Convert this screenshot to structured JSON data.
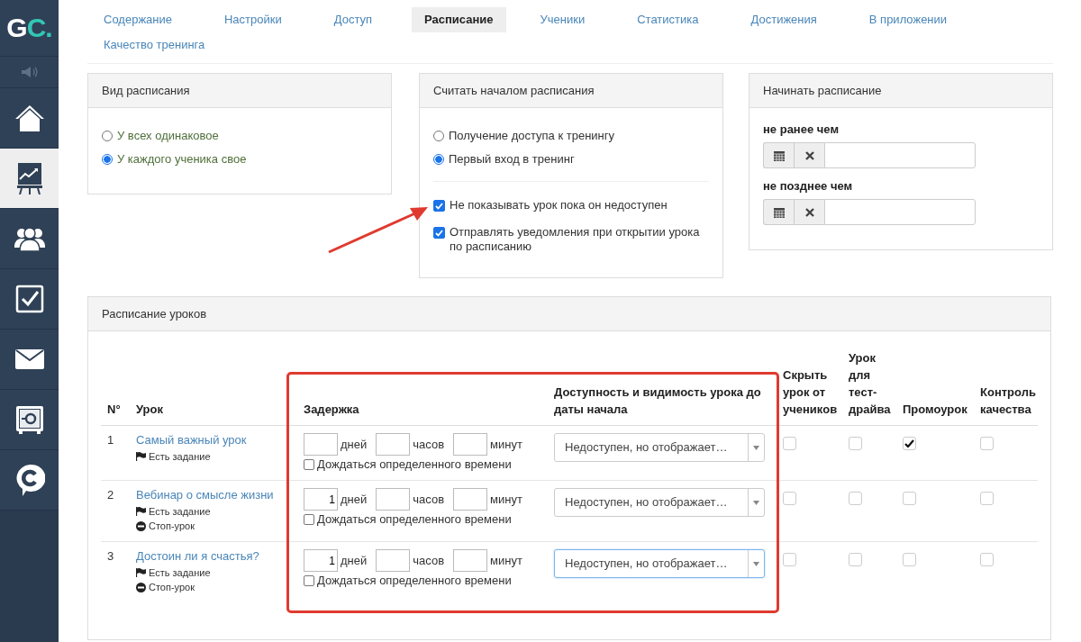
{
  "sidebar": {
    "logo": {
      "letter_1": "G",
      "letter_2": "C",
      "dot": "."
    },
    "items": [
      {
        "kind": "speaker",
        "selected": false
      },
      {
        "kind": "home",
        "selected": false
      },
      {
        "kind": "chart",
        "selected": true
      },
      {
        "kind": "users",
        "selected": false
      },
      {
        "kind": "check",
        "selected": false
      },
      {
        "kind": "mail",
        "selected": false
      },
      {
        "kind": "safe",
        "selected": false
      },
      {
        "kind": "chat",
        "selected": false
      }
    ]
  },
  "tabs": [
    {
      "label": "Содержание",
      "selected": false
    },
    {
      "label": "Настройки",
      "selected": false
    },
    {
      "label": "Доступ",
      "selected": false
    },
    {
      "label": "Расписание",
      "selected": true
    },
    {
      "label": "Ученики",
      "selected": false
    },
    {
      "label": "Статистика",
      "selected": false
    },
    {
      "label": "Достижения",
      "selected": false
    },
    {
      "label": "В приложении",
      "selected": false
    },
    {
      "label": "Качество тренинга",
      "selected": false
    }
  ],
  "schedule_type": {
    "title": "Вид расписания",
    "options": [
      {
        "label": "У всех одинаковое",
        "selected": false
      },
      {
        "label": "У каждого ученика свое",
        "selected": true
      }
    ]
  },
  "schedule_start": {
    "title": "Считать началом расписания",
    "options": [
      {
        "label": "Получение доступа к тренингу",
        "selected": false
      },
      {
        "label": "Первый вход в тренинг",
        "selected": true
      }
    ],
    "checkboxes": [
      {
        "label": "Не показывать урок пока он недоступен",
        "checked": true
      },
      {
        "label": "Отправлять уведомления при открытии урока по расписанию",
        "checked": true
      }
    ]
  },
  "start_window": {
    "title": "Начинать расписание",
    "fields": [
      {
        "label": "не ранее чем"
      },
      {
        "label": "не позднее чем"
      }
    ]
  },
  "lessons": {
    "title": "Расписание уроков",
    "columns": [
      "N°",
      "Урок",
      "Задержка",
      "Доступность и видимость урока до даты начала",
      "Скрыть урок от учеников",
      "Урок для тест-драйва",
      "Промоурок",
      "Контроль качества"
    ],
    "rows": [
      {
        "number": "1",
        "title": "Самый важный урок",
        "tags": [
          {
            "kind": "task",
            "label": "Есть задание"
          }
        ],
        "days": "",
        "hours": "",
        "minutes": "",
        "days_unit": "дней",
        "hours_unit": "часов",
        "minutes_unit": "минут",
        "wait_label": "Дождаться определенного времени",
        "wait": false,
        "availability": "Недоступен, но отображает…",
        "focused": false,
        "hide": false,
        "test_drive": false,
        "promo": true,
        "quality": false
      },
      {
        "number": "2",
        "title": "Вебинар о смысле жизни",
        "tags": [
          {
            "kind": "task",
            "label": "Есть задание"
          },
          {
            "kind": "stop",
            "label": "Стоп-урок"
          }
        ],
        "days": "1",
        "hours": "",
        "minutes": "",
        "days_unit": "дней",
        "hours_unit": "часов",
        "minutes_unit": "минут",
        "wait_label": "Дождаться определенного времени",
        "wait": false,
        "availability": "Недоступен, но отображает…",
        "focused": false,
        "hide": false,
        "test_drive": false,
        "promo": false,
        "quality": false
      },
      {
        "number": "3",
        "title": "Достоин ли я счастья?",
        "tags": [
          {
            "kind": "task",
            "label": "Есть задание"
          },
          {
            "kind": "stop",
            "label": "Стоп-урок"
          }
        ],
        "days": "1",
        "hours": "",
        "minutes": "",
        "days_unit": "дней",
        "hours_unit": "часов",
        "minutes_unit": "минут",
        "wait_label": "Дождаться определенного времени",
        "wait": false,
        "availability": "Недоступен, но отображает…",
        "focused": true,
        "hide": false,
        "test_drive": false,
        "promo": false,
        "quality": false
      }
    ]
  }
}
